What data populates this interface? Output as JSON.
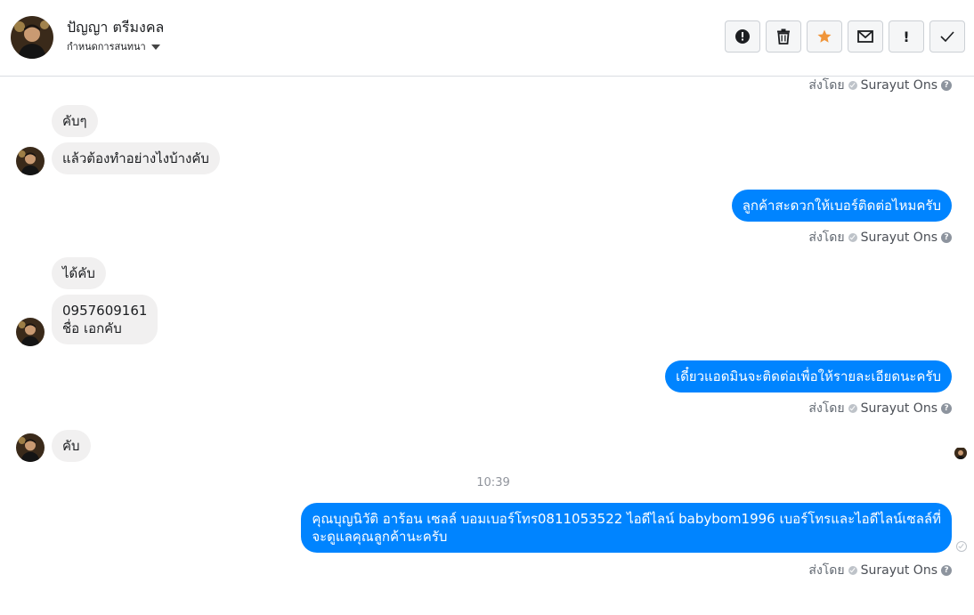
{
  "header": {
    "contact_name": "ปัญญา ตรีมงคล",
    "subtitle": "กำหนดการสนทนา",
    "toolbar": {
      "spam_icon": "alert-circle-icon",
      "delete_icon": "trash-icon",
      "star_icon": "star-icon",
      "star_color": "#f0953a",
      "mark_unread_icon": "envelope-icon",
      "important_label": "!",
      "done_icon": "check-icon"
    }
  },
  "sent_by": {
    "prefix": "ส่งโดย",
    "name": "Surayut Ons",
    "help": "?"
  },
  "messages": {
    "m1": "คับๆ",
    "m2": "แล้วต้องทำอย่างไงบ้างคับ",
    "m3": "ลูกค้าสะดวกให้เบอร์ติดต่อไหมครับ",
    "m4": "ได้คับ",
    "m5_line1": "0957609161",
    "m5_line2": "ชื่อ เอกคับ",
    "m6": "เดี๋ยวแอดมินจะติดต่อเพื่อให้รายละเอียดนะครับ",
    "m7": "คับ",
    "m8_line1": "คุณบุญนิวัติ อาร้อน เซลล์ บอมเบอร์โทร0811053522 ไอดีไลน์ babybom1996  เบอร์โทรและไอดีไลน์เซลล์ที่",
    "m8_line2": "จะดูแลคุณลูกค้านะครับ"
  },
  "timestamp": "10:39",
  "colors": {
    "outgoing_bubble": "#0084ff",
    "incoming_bubble": "#f1f0f0"
  }
}
